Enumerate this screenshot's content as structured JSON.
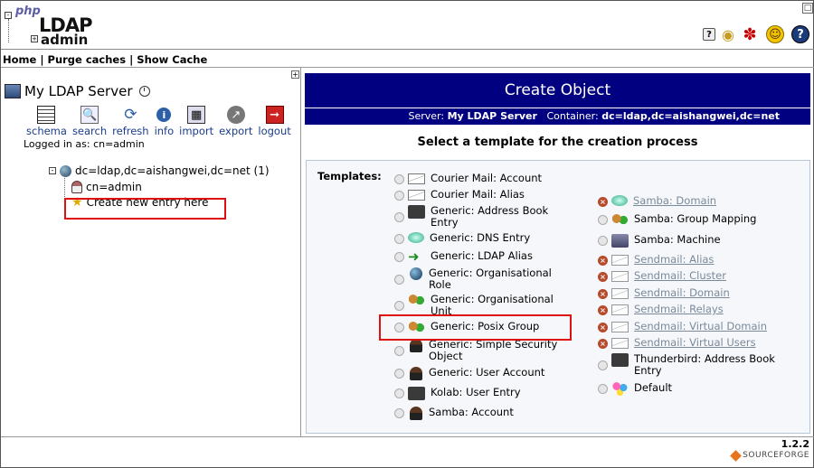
{
  "logo": {
    "php": "php",
    "ldap": "LDAP",
    "admin": "admin"
  },
  "header_icons": [
    "help-icon",
    "donate-medal-icon",
    "bug-icon",
    "smiley-icon",
    "question-icon"
  ],
  "nav": {
    "home": "Home",
    "purge": "Purge caches",
    "show_cache": "Show Cache",
    "sep": "|"
  },
  "left": {
    "server_name": "My LDAP Server",
    "tools": [
      {
        "label": "schema",
        "icon": "schema-icon"
      },
      {
        "label": "search",
        "icon": "search-icon"
      },
      {
        "label": "refresh",
        "icon": "refresh-icon"
      },
      {
        "label": "info",
        "icon": "info-icon"
      },
      {
        "label": "import",
        "icon": "import-icon"
      },
      {
        "label": "export",
        "icon": "export-icon"
      },
      {
        "label": "logout",
        "icon": "logout-icon"
      }
    ],
    "logged_in": "Logged in as: cn=admin",
    "tree": {
      "root": "dc=ldap,dc=aishangwei,dc=net (1)",
      "child": "cn=admin",
      "create": "Create new entry here"
    }
  },
  "right": {
    "title": "Create Object",
    "server_label": "Server:",
    "server": "My LDAP Server",
    "container_label": "Container:",
    "container": "dc=ldap,dc=aishangwei,dc=net",
    "subtitle": "Select a template for the creation process",
    "templates_label": "Templates:",
    "templates_left": [
      {
        "label": "Courier Mail: Account",
        "icon": "mail-account-icon",
        "enabled": true
      },
      {
        "label": "Courier Mail: Alias",
        "icon": "mail-alias-icon",
        "enabled": true
      },
      {
        "label": "Generic: Address Book Entry",
        "icon": "address-book-icon",
        "enabled": true
      },
      {
        "label": "Generic: DNS Entry",
        "icon": "dns-icon",
        "enabled": true
      },
      {
        "label": "Generic: LDAP Alias",
        "icon": "arrow-icon",
        "enabled": true
      },
      {
        "label": "Generic: Organisational Role",
        "icon": "globe-icon",
        "enabled": true
      },
      {
        "label": "Generic: Organisational Unit",
        "icon": "group-icon",
        "enabled": true
      },
      {
        "label": "Generic: Posix Group",
        "icon": "group-icon",
        "enabled": true
      },
      {
        "label": "Generic: Simple Security Object",
        "icon": "person-icon",
        "enabled": true
      },
      {
        "label": "Generic: User Account",
        "icon": "person-icon",
        "enabled": true
      },
      {
        "label": "Kolab: User Entry",
        "icon": "address-book-icon",
        "enabled": true
      },
      {
        "label": "Samba: Account",
        "icon": "person-icon",
        "enabled": true
      }
    ],
    "templates_right": [
      {
        "label": "Samba: Domain",
        "icon": "dns-icon",
        "enabled": false
      },
      {
        "label": "Samba: Group Mapping",
        "icon": "group-icon",
        "enabled": true
      },
      {
        "label": "Samba: Machine",
        "icon": "machine-icon",
        "enabled": true
      },
      {
        "label": "Sendmail: Alias",
        "icon": "mail-icon",
        "enabled": false
      },
      {
        "label": "Sendmail: Cluster",
        "icon": "mail-icon",
        "enabled": false
      },
      {
        "label": "Sendmail: Domain",
        "icon": "mail-icon",
        "enabled": false
      },
      {
        "label": "Sendmail: Relays",
        "icon": "mail-icon",
        "enabled": false
      },
      {
        "label": "Sendmail: Virtual Domain",
        "icon": "mail-icon",
        "enabled": false
      },
      {
        "label": "Sendmail: Virtual Users",
        "icon": "mail-icon",
        "enabled": false
      },
      {
        "label": "Thunderbird: Address Book Entry",
        "icon": "address-book-icon",
        "enabled": true
      },
      {
        "label": "Default",
        "icon": "default-icon",
        "enabled": true
      }
    ]
  },
  "footer": {
    "version": "1.2.2",
    "sf": "SOURCEFORGE"
  },
  "colors": {
    "header_bar": "#000080",
    "highlight": "#e01010",
    "disabled_link": "#7a8a9a"
  }
}
